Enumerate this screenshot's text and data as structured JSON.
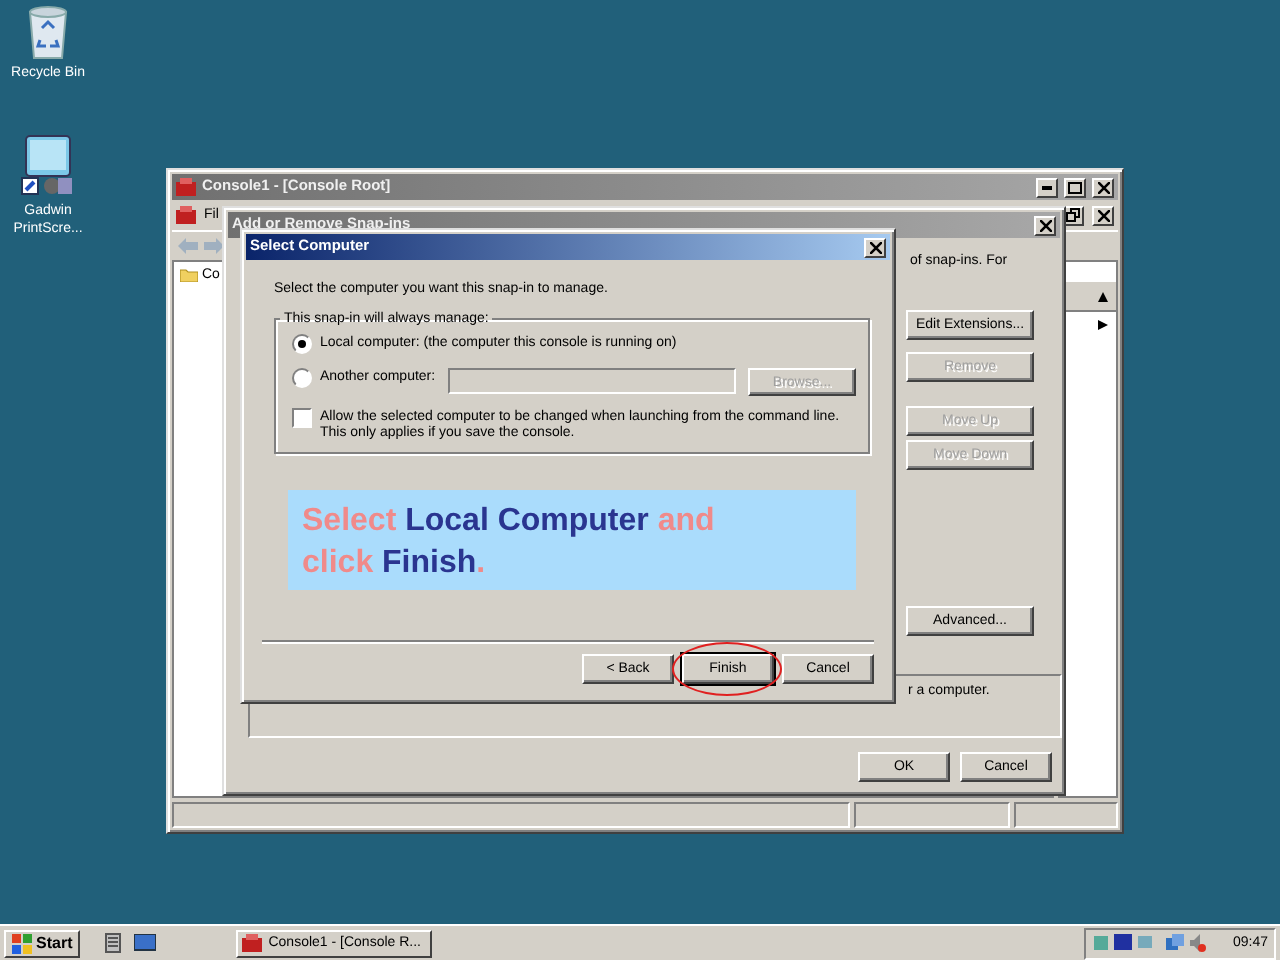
{
  "desktop_icons": [
    {
      "label": "Recycle Bin",
      "kind": "recycle"
    },
    {
      "label": "Gadwin PrintScre...",
      "kind": "app"
    }
  ],
  "console": {
    "title": "Console1 - [Console Root]",
    "menu": [
      "Fil"
    ],
    "tree_item": "Co"
  },
  "snapin_dialog": {
    "title": "Add or Remove Snap-ins",
    "intro": "of snap-ins. For",
    "side_buttons": [
      {
        "label": "Edit Extensions...",
        "disabled": false
      },
      {
        "label": "Remove",
        "disabled": true
      },
      {
        "label": "Move Up",
        "disabled": true
      },
      {
        "label": "Move Down",
        "disabled": true
      },
      {
        "label": "Advanced...",
        "disabled": false
      }
    ],
    "description": "r a computer.",
    "buttons": [
      "OK",
      "Cancel"
    ]
  },
  "select_dialog": {
    "title": "Select Computer",
    "prompt": "Select the computer you want this snap-in to manage.",
    "group_label": "This snap-in will always manage:",
    "options": [
      {
        "kind": "radio",
        "label": "Local computer:  (the computer this console is running on)",
        "selected": true
      },
      {
        "kind": "radio",
        "label": "Another computer:",
        "selected": false,
        "field_disabled": true,
        "browse": {
          "label": "Browse...",
          "disabled": true
        }
      },
      {
        "kind": "checkbox",
        "label": "Allow the selected computer to be changed when launching from the command line.  This only applies if you save the console.",
        "checked": false
      }
    ],
    "callout": "Select **Local Computer** and click **Finish**.",
    "buttons": [
      {
        "label": "< Back",
        "default": false,
        "highlighted": false
      },
      {
        "label": "Finish",
        "default": true,
        "highlighted": true
      },
      {
        "label": "Cancel",
        "default": false,
        "highlighted": false
      }
    ]
  },
  "taskbar": {
    "start": "Start",
    "tasks": [
      {
        "label": "Console1 - [Console R...",
        "selected": false
      }
    ],
    "clock": "09:47"
  }
}
